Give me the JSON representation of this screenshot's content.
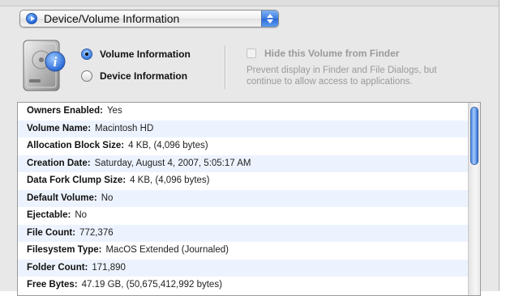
{
  "popup": {
    "label": "Device/Volume Information",
    "icon": "play-circle-icon"
  },
  "disk_icon": "hard-disk-info-icon",
  "view_mode": {
    "options": [
      {
        "label": "Volume Information",
        "selected": true
      },
      {
        "label": "Device Information",
        "selected": false
      }
    ]
  },
  "hide_volume": {
    "label": "Hide this Volume from Finder",
    "checked": false,
    "enabled": false,
    "description": "Prevent display in Finder and File Dialogs, but continue to allow access to applications."
  },
  "info_rows": [
    {
      "key": "Owners Enabled:",
      "value": "Yes"
    },
    {
      "key": "Volume Name:",
      "value": "Macintosh HD"
    },
    {
      "key": "Allocation Block Size:",
      "value": "4 KB, (4,096 bytes)"
    },
    {
      "key": "Creation Date:",
      "value": "Saturday, August 4, 2007, 5:05:17 AM"
    },
    {
      "key": "Data Fork Clump Size:",
      "value": "4 KB, (4,096 bytes)"
    },
    {
      "key": "Default Volume:",
      "value": "No"
    },
    {
      "key": "Ejectable:",
      "value": "No"
    },
    {
      "key": "File Count:",
      "value": "772,376"
    },
    {
      "key": "Filesystem Type:",
      "value": "MacOS Extended (Journaled)"
    },
    {
      "key": "Folder Count:",
      "value": "171,890"
    },
    {
      "key": "Free Bytes:",
      "value": "47.19 GB, (50,675,412,992 bytes)"
    }
  ],
  "colors": {
    "accent": "#3478e0",
    "row_alt": "#edf3fe",
    "disabled_text": "#9a9a9a"
  }
}
